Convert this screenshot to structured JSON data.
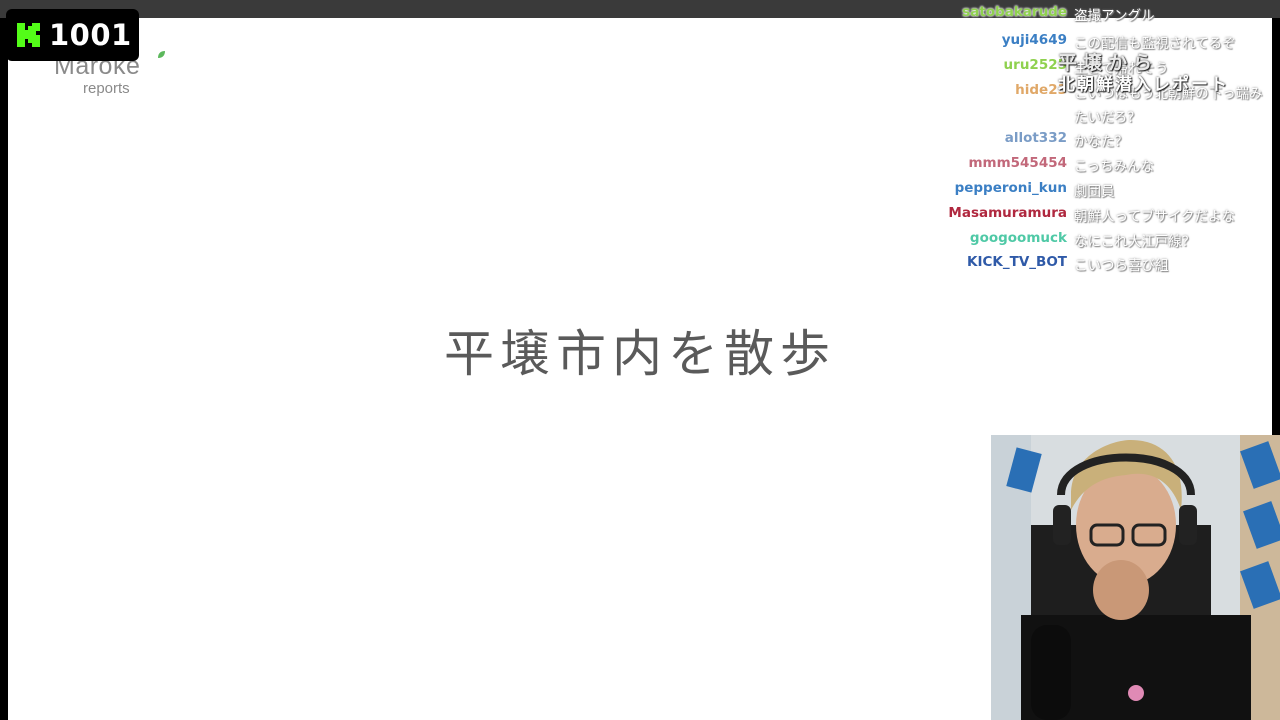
{
  "viewer_badge": {
    "count": "1001",
    "icon": "kick-logo-icon",
    "accent": "#53fc18"
  },
  "slide": {
    "logo_word": "Maroke",
    "logo_sub": "reports",
    "title": "平壌市内を散歩"
  },
  "chat": [
    {
      "user": "satobakarude",
      "message": "盗撮アングル",
      "color": "#8fd14f"
    },
    {
      "user": "yuji4649",
      "message": "この配信も監視されてるぞ",
      "color": "#3b7fc4"
    },
    {
      "user": "uru2525",
      "message": "生きて帰れそう",
      "color": "#8fd14f"
    },
    {
      "user": "hide23",
      "message": "こいつはもう北朝鮮の下っ端みたいだろ？",
      "color": "#e0a868"
    },
    {
      "user": "allot332",
      "message": "かなた？",
      "color": "#7a9cc6"
    },
    {
      "user": "mmm545454",
      "message": "こっちみんな",
      "color": "#c2687a"
    },
    {
      "user": "pepperoni_kun",
      "message": "劇団員",
      "color": "#3b7fc4"
    },
    {
      "user": "Masamuramura",
      "message": "朝鮮人ってブサイクだよな",
      "color": "#b0283f"
    },
    {
      "user": "googoomuck",
      "message": "なにこれ大江戸線？",
      "color": "#4fc9a6"
    },
    {
      "user": "KICK_TV_BOT",
      "message": "こいつら喜び組",
      "color": "#2f5aa8"
    }
  ],
  "overlay_text": {
    "line1": "北朝鮮潜入レポート",
    "line2": "平壌から"
  },
  "webcam": {
    "label": "streamer-webcam"
  }
}
